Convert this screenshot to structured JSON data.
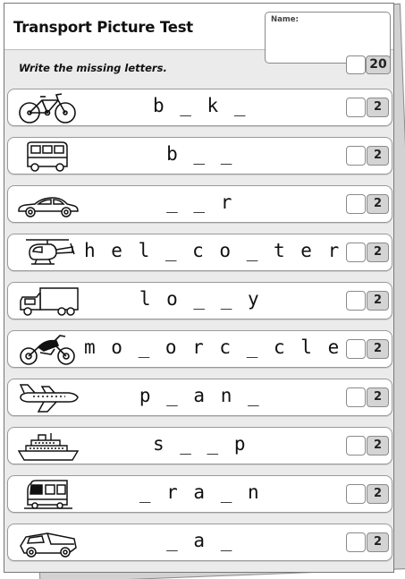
{
  "worksheet": {
    "title": "Transport Picture Test",
    "name_label": "Name:",
    "total_score": "20",
    "instruction": "Write the missing letters."
  },
  "items": [
    {
      "icon": "bicycle-icon",
      "word": "b _ k _",
      "score": "2"
    },
    {
      "icon": "bus-icon",
      "word": "b _ _",
      "score": "2"
    },
    {
      "icon": "car-icon",
      "word": "_ _ r",
      "score": "2"
    },
    {
      "icon": "helicopter-icon",
      "word": "h e l _ c o _ t e r",
      "score": "2"
    },
    {
      "icon": "lorry-icon",
      "word": "l o _ _ y",
      "score": "2"
    },
    {
      "icon": "motorcycle-icon",
      "word": "m o _ o r c _ c l e",
      "score": "2"
    },
    {
      "icon": "plane-icon",
      "word": "p _ a n _",
      "score": "2"
    },
    {
      "icon": "ship-icon",
      "word": "s _ _ p",
      "score": "2"
    },
    {
      "icon": "train-icon",
      "word": "_ r a _ n",
      "score": "2"
    },
    {
      "icon": "van-icon",
      "word": "_ a _",
      "score": "2"
    }
  ]
}
